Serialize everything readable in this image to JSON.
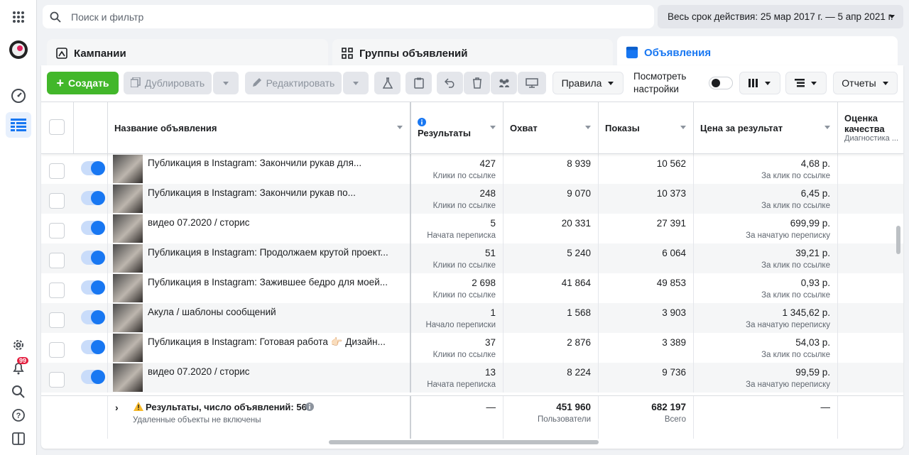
{
  "search": {
    "placeholder": "Поиск и фильтр"
  },
  "date_range": "Весь срок действия: 25 мар 2017 г. — 5 апр 2021 г.",
  "tabs": [
    {
      "label": "Кампании"
    },
    {
      "label": "Группы объявлений"
    },
    {
      "label": "Объявления"
    }
  ],
  "toolbar": {
    "create": "Создать",
    "duplicate": "Дублировать",
    "edit": "Редактировать",
    "rules": "Правила",
    "view_settings": "Посмотреть настройки",
    "reports": "Отчеты"
  },
  "columns": {
    "name": "Название объявления",
    "results": "Результаты",
    "reach": "Охват",
    "impressions": "Показы",
    "cost": "Цена за результат",
    "quality": "Оценка качества",
    "quality_sub": "Диагностика ..."
  },
  "rows": [
    {
      "name": "Публикация в Instagram: Закончили рукав для...",
      "results": "427",
      "results_type": "Клики по ссылке",
      "reach": "8 939",
      "impressions": "10 562",
      "cost": "4,68 р.",
      "cost_type": "За клик по ссылке"
    },
    {
      "name": "Публикация в Instagram: Закончили рукав по...",
      "results": "248",
      "results_type": "Клики по ссылке",
      "reach": "9 070",
      "impressions": "10 373",
      "cost": "6,45 р.",
      "cost_type": "За клик по ссылке"
    },
    {
      "name": "видео 07.2020 / сторис",
      "results": "5",
      "results_type": "Начата переписка",
      "reach": "20 331",
      "impressions": "27 391",
      "cost": "699,99 р.",
      "cost_type": "За начатую переписку"
    },
    {
      "name": "Публикация в Instagram: Продолжаем крутой проект...",
      "results": "51",
      "results_type": "Клики по ссылке",
      "reach": "5 240",
      "impressions": "6 064",
      "cost": "39,21 р.",
      "cost_type": "За клик по ссылке"
    },
    {
      "name": "Публикация в Instagram: Зажившее бедро для моей...",
      "results": "2 698",
      "results_type": "Клики по ссылке",
      "reach": "41 864",
      "impressions": "49 853",
      "cost": "0,93 р.",
      "cost_type": "За клик по ссылке"
    },
    {
      "name": "Акула / шаблоны сообщений",
      "results": "1",
      "results_type": "Начало переписки",
      "reach": "1 568",
      "impressions": "3 903",
      "cost": "1 345,62 р.",
      "cost_type": "За начатую переписку"
    },
    {
      "name": "Публикация в Instagram: Готовая работа 👉🏻 Дизайн...",
      "results": "37",
      "results_type": "Клики по ссылке",
      "reach": "2 876",
      "impressions": "3 389",
      "cost": "54,03 р.",
      "cost_type": "За клик по ссылке"
    },
    {
      "name": "видео 07.2020 / сторис",
      "results": "13",
      "results_type": "Начата переписка",
      "reach": "8 224",
      "impressions": "9 736",
      "cost": "99,59 р.",
      "cost_type": "За начатую переписку"
    }
  ],
  "footer": {
    "summary": "Результаты, число объявлений: 56",
    "note": "Удаленные объекты не включены",
    "results": "—",
    "reach": "451 960",
    "reach_sub": "Пользователи",
    "impressions": "682 197",
    "impressions_sub": "Всего",
    "cost": "—"
  },
  "notifications_badge": "99",
  "colors": {
    "accent": "#1877f2",
    "create": "#42b72a"
  }
}
